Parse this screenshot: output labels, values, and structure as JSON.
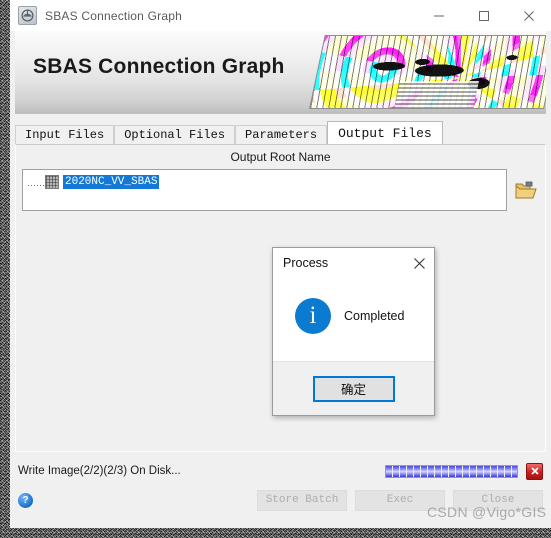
{
  "window": {
    "title": "SBAS Connection Graph",
    "app_icon": "app-logo-icon",
    "minimize_label": "minimize-icon",
    "maximize_label": "maximize-icon",
    "close_label": "close-icon"
  },
  "banner": {
    "title": "SBAS Connection Graph",
    "image_alt": "interferogram-fringe-image"
  },
  "tabs": [
    {
      "label": "Input Files",
      "active": false
    },
    {
      "label": "Optional Files",
      "active": false
    },
    {
      "label": "Parameters",
      "active": false
    },
    {
      "label": "Output Files",
      "active": true
    }
  ],
  "panel": {
    "section_label": "Output Root Name",
    "item": {
      "name": "2020NC_VV_SBAS",
      "icon": "raster-grid-icon",
      "selected": true
    },
    "browse_icon": "open-folder-icon"
  },
  "status": {
    "message": "Write Image(2/2)(2/3) On Disk...",
    "progress_percent": 100,
    "stop_icon": "stop-x-icon"
  },
  "footer": {
    "help_icon": "?",
    "buttons": [
      {
        "label": "Store Batch",
        "enabled": false
      },
      {
        "label": "Exec",
        "enabled": false
      },
      {
        "label": "Close",
        "enabled": false
      }
    ]
  },
  "dialog": {
    "title": "Process",
    "close_icon": "close-icon",
    "info_icon": "i",
    "message": "Completed",
    "ok_label": "确定"
  },
  "watermark": {
    "text": "CSDN @Vigo*GIS"
  },
  "colors": {
    "accent_blue": "#0078D7",
    "selection_blue": "#1479D6",
    "stop_red": "#CC2020",
    "window_bg": "#F0F0F0"
  }
}
